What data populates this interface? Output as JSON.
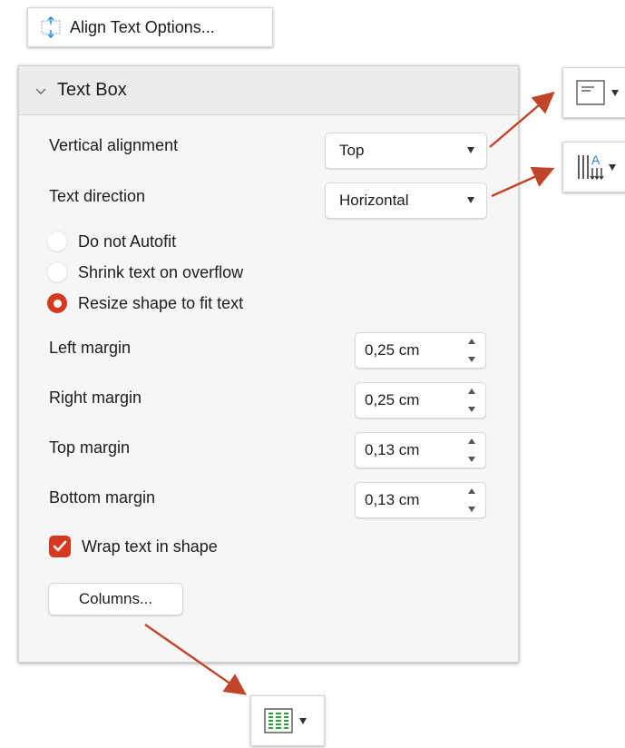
{
  "align_button": {
    "label": "Align Text Options..."
  },
  "panel": {
    "title": "Text Box",
    "vertical_alignment": {
      "label": "Vertical alignment",
      "value": "Top"
    },
    "text_direction": {
      "label": "Text direction",
      "value": "Horizontal"
    },
    "autofit": {
      "options": [
        "Do not Autofit",
        "Shrink text on overflow",
        "Resize shape to fit text"
      ],
      "selected": "Resize shape to fit text"
    },
    "margins": [
      {
        "label": "Left margin",
        "value": "0,25 cm"
      },
      {
        "label": "Right margin",
        "value": "0,25 cm"
      },
      {
        "label": "Top margin",
        "value": "0,13 cm"
      },
      {
        "label": "Bottom margin",
        "value": "0,13 cm"
      }
    ],
    "wrap_text": {
      "label": "Wrap text in shape",
      "checked": true
    },
    "columns_button": {
      "label": "Columns..."
    }
  },
  "toolbar_icons": [
    {
      "name": "align-text-icon"
    },
    {
      "name": "text-direction-icon"
    },
    {
      "name": "columns-icon"
    }
  ],
  "colors": {
    "accent": "#d43a20",
    "annotation_arrow": "#c0442a",
    "panel_bg": "#f6f6f6",
    "header_bg": "#ececec",
    "columns_icon": "#2e9e3f",
    "text_direction_icon_letter": "#2f7fd1"
  }
}
